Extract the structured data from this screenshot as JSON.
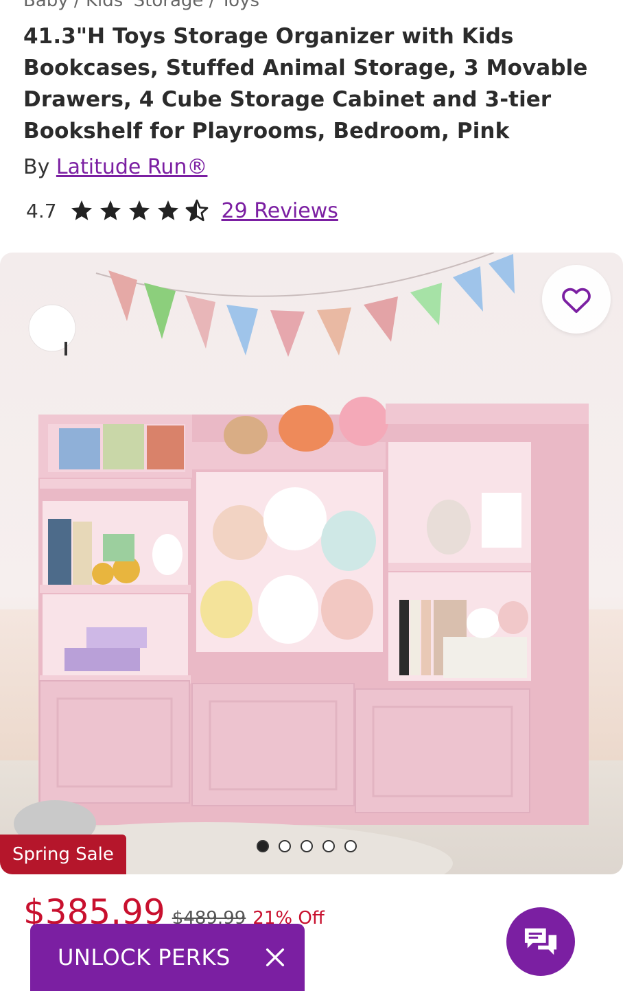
{
  "breadcrumb": "Baby / Kids' Storage / Toys",
  "product": {
    "title": "41.3\"H Toys Storage Organizer with Kids Bookcases, Stuffed Animal Storage, 3 Movable Drawers, 4 Cube Storage Cabinet and 3-tier Bookshelf for Playrooms, Bedroom, Pink",
    "by_label": "By",
    "brand": "Latitude Run®",
    "rating": "4.7",
    "stars_value": 4.7,
    "reviews_label": "29 Reviews"
  },
  "gallery": {
    "badge": "Spring Sale",
    "dots_total": 5,
    "active_dot": 1
  },
  "pricing": {
    "price": "$385.99",
    "original": "$489.99",
    "discount": "21% Off"
  },
  "promo": {
    "label": "UNLOCK PERKS"
  },
  "colors": {
    "accent": "#7b1fa2",
    "sale": "#b5162b",
    "price": "#c8102e"
  }
}
